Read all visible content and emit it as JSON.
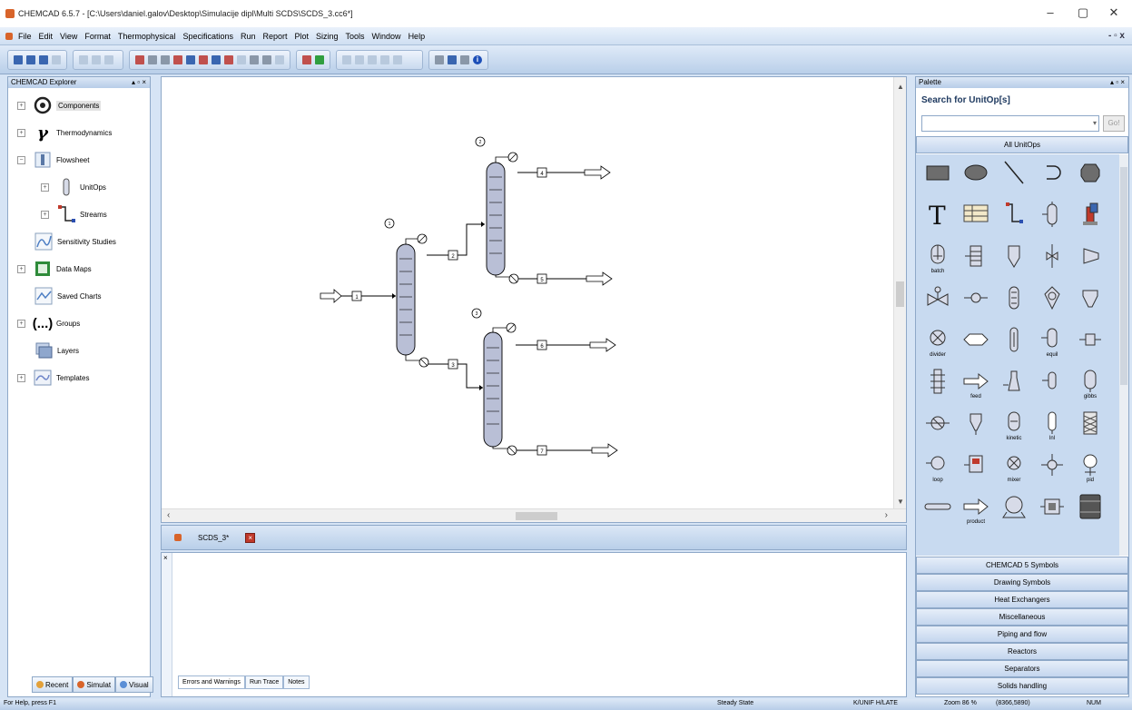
{
  "window": {
    "title": "CHEMCAD 6.5.7 - [C:\\Users\\daniel.galov\\Desktop\\Simulacije dipl\\Multi SCDS\\SCDS_3.cc6*]",
    "minimize": "–",
    "maximize": "▢",
    "close": "✕"
  },
  "menu": {
    "items": [
      "File",
      "Edit",
      "View",
      "Format",
      "Thermophysical",
      "Specifications",
      "Run",
      "Report",
      "Plot",
      "Sizing",
      "Tools",
      "Window",
      "Help"
    ],
    "mdi_controls": "- ▫ x"
  },
  "explorer": {
    "title": "CHEMCAD Explorer",
    "controls": "▴ ▫ ×",
    "items": [
      {
        "label": "Components",
        "icon": "molecule-icon"
      },
      {
        "label": "Thermodynamics",
        "icon": "gamma-icon"
      },
      {
        "label": "Flowsheet",
        "icon": "flowsheet-icon"
      },
      {
        "label": "UnitOps",
        "icon": "column-icon"
      },
      {
        "label": "Streams",
        "icon": "streams-icon"
      },
      {
        "label": "Sensitivity Studies",
        "icon": "sensitivity-icon"
      },
      {
        "label": "Data Maps",
        "icon": "datamap-icon"
      },
      {
        "label": "Saved Charts",
        "icon": "chart-icon"
      },
      {
        "label": "Groups",
        "icon": "groups-icon"
      },
      {
        "label": "Layers",
        "icon": "layers-icon"
      },
      {
        "label": "Templates",
        "icon": "templates-icon"
      }
    ],
    "tabs": [
      "Recent",
      "Simulat",
      "Visual"
    ]
  },
  "flowsheet": {
    "unit_labels": [
      "1",
      "2",
      "3"
    ],
    "stream_labels": [
      "1",
      "2",
      "3",
      "4",
      "5",
      "6",
      "7"
    ],
    "unit_colors": {
      "column": "#b9bfd6",
      "line": "#000000"
    }
  },
  "document_tab": {
    "name": "SCDS_3*",
    "close_label": "×"
  },
  "messages": {
    "side_label": "×",
    "tabs": [
      "Errors and Warnings",
      "Run Trace",
      "Notes"
    ]
  },
  "palette": {
    "title": "Palette",
    "controls": "▴ ▫ ×",
    "search_title": "Search for UnitOp[s]",
    "search_value": "",
    "go_label": "Go!",
    "all_label": "All UnitOps",
    "item_labels": {
      "batch": "batch",
      "divider": "divider",
      "equil": "equil",
      "feed": "feed",
      "gibbs": "gibbs",
      "kinetic": "kinetic",
      "lnl": "lnl",
      "loop": "loop",
      "mixer": "mixer",
      "pid": "pid",
      "product": "product"
    },
    "categories": [
      "CHEMCAD 5 Symbols",
      "Drawing Symbols",
      "Heat Exchangers",
      "Miscellaneous",
      "Piping and flow",
      "Reactors",
      "Separators",
      "Solids handling"
    ]
  },
  "status": {
    "help": "For Help, press F1",
    "state": "Steady State",
    "units": "K/UNIF H/LATE",
    "zoom": "Zoom 86 %",
    "coords": "(8366,5890)",
    "num": "NUM"
  }
}
